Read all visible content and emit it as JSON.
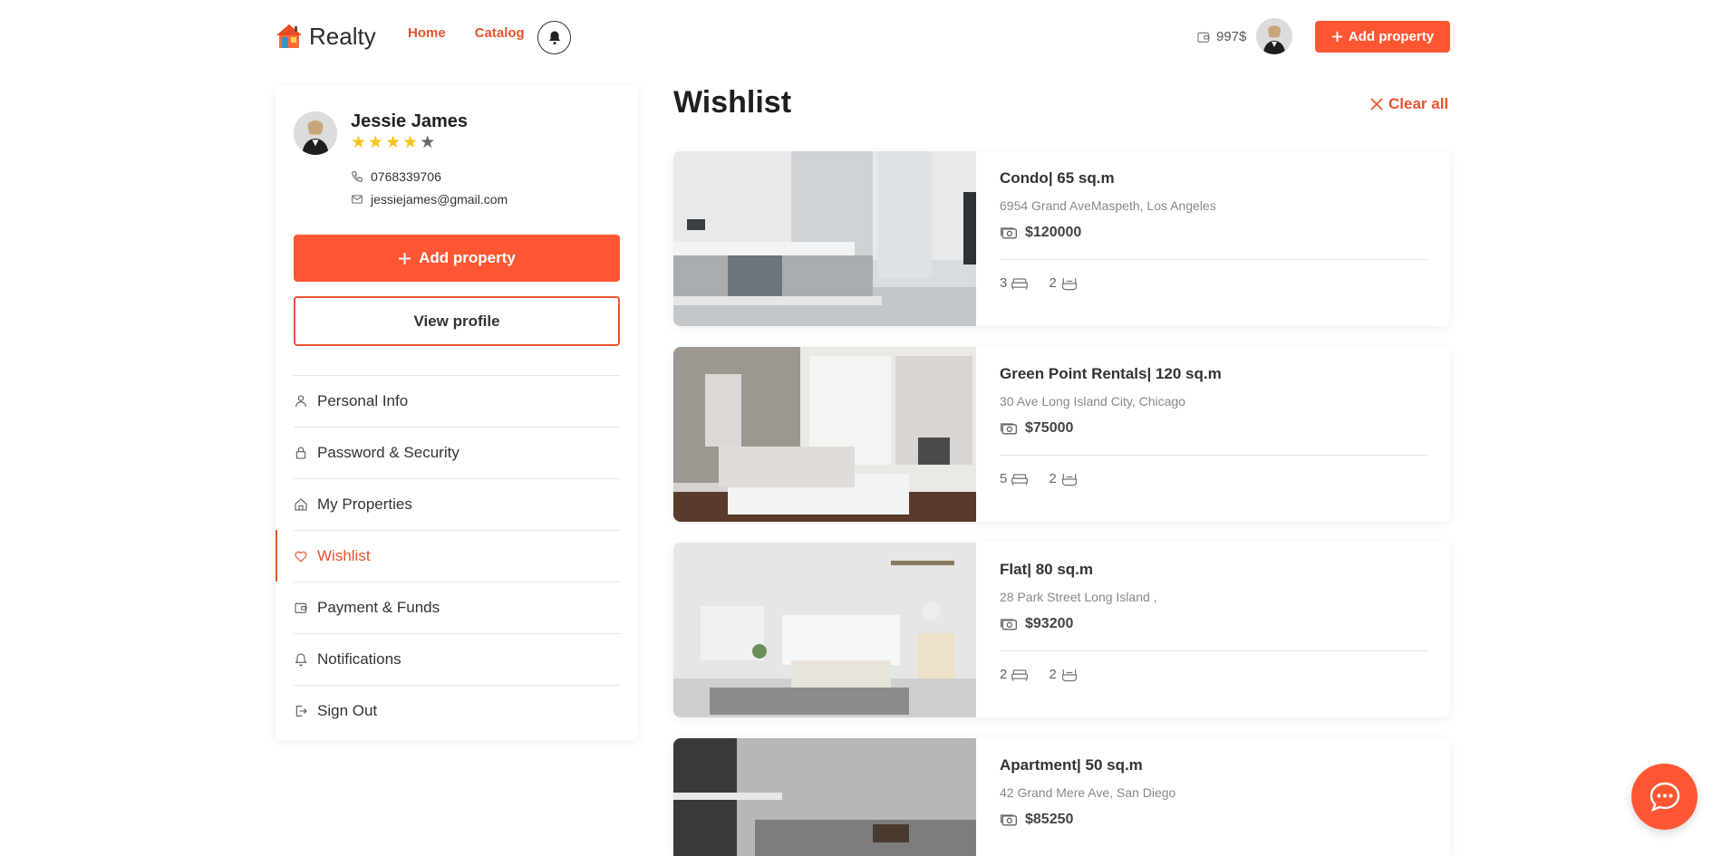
{
  "header": {
    "logo_text": "Realty",
    "nav": [
      {
        "label": "Home"
      },
      {
        "label": "Catalog"
      }
    ],
    "balance": "997$",
    "add_property_label": "Add property"
  },
  "profile": {
    "name": "Jessie James",
    "rating": 4,
    "rating_max": 5,
    "phone": "0768339706",
    "email": "jessiejames@gmail.com",
    "add_property_label": "Add property",
    "view_profile_label": "View profile"
  },
  "menu": [
    {
      "label": "Personal Info",
      "icon": "user-icon",
      "active": false
    },
    {
      "label": "Password & Security",
      "icon": "lock-icon",
      "active": false
    },
    {
      "label": "My Properties",
      "icon": "home-icon",
      "active": false
    },
    {
      "label": "Wishlist",
      "icon": "heart-icon",
      "active": true
    },
    {
      "label": "Payment & Funds",
      "icon": "wallet-icon",
      "active": false
    },
    {
      "label": "Notifications",
      "icon": "bell-icon",
      "active": false
    },
    {
      "label": "Sign Out",
      "icon": "sign-out-icon",
      "active": false
    }
  ],
  "main": {
    "title": "Wishlist",
    "clear_all_label": "Clear all",
    "properties": [
      {
        "title": "Condo| 65 sq.m",
        "address": "6954 Grand AveMaspeth, Los Angeles",
        "price": "$120000",
        "beds": "3",
        "baths": "2"
      },
      {
        "title": "Green Point Rentals| 120 sq.m",
        "address": "30 Ave Long Island City, Chicago",
        "price": "$75000",
        "beds": "5",
        "baths": "2"
      },
      {
        "title": "Flat| 80 sq.m",
        "address": "28 Park Street Long Island ,",
        "price": "$93200",
        "beds": "2",
        "baths": "2"
      },
      {
        "title": "Apartment| 50 sq.m",
        "address": "42 Grand Mere Ave, San Diego",
        "price": "$85250",
        "beds": "",
        "baths": ""
      }
    ]
  },
  "colors": {
    "accent": "#ff5733",
    "accent_text": "#e9532f",
    "star": "#f5c518"
  }
}
